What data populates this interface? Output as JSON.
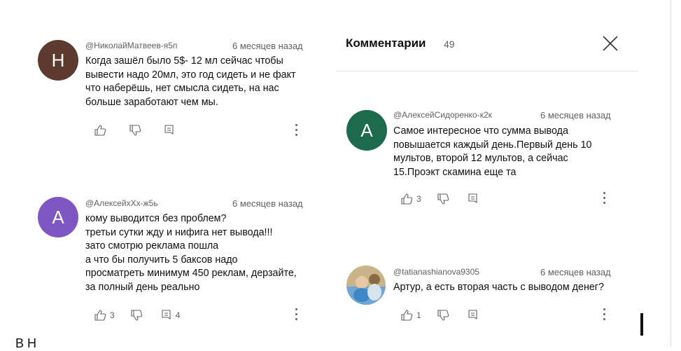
{
  "header": {
    "title": "Комментарии",
    "count": "49"
  },
  "comments_left": [
    {
      "avatar_letter": "Н",
      "avatar_color": "#5d3a2e",
      "author": "@НиколайМатвеев-я5п",
      "time": "6 месяцев назад",
      "text": "Когда зашёл было 5$- 12 мл сейчас чтобы\nвывести надо 20мл, это год сидеть и не факт\nчто наберёшь, нет смысла сидеть, на нас\nбольше заработают чем мы.",
      "likes": "",
      "replies": ""
    },
    {
      "avatar_letter": "А",
      "avatar_color": "#7e57c2",
      "author": "@АлексейхХх-ж5ь",
      "time": "6 месяцев назад",
      "text": "кому выводится без проблем?\nтретьи сутки жду и нифига нет вывода!!!\nзато смотрю реклама пошла\nа что бы получить 5 баксов надо\nпросматреть минимум 450 реклам, дерзайте,\nза полный день реально",
      "likes": "3",
      "replies": "4"
    }
  ],
  "comments_right": [
    {
      "avatar_letter": "А",
      "avatar_color": "#1e6a4e",
      "author": "@АлексейСидоренко-к2к",
      "time": "6 месяцев назад",
      "text": "Самое интересное что сумма вывода\nповышается каждый день.Первый день 10\nмультов, второй 12 мультов, а сейчас\n15.Проэкт скамина еще та",
      "likes": "3"
    },
    {
      "avatar_letter": "",
      "avatar_color": "#8fb8d8",
      "author": "@tatianashianova9305",
      "time": "6 месяцев назад",
      "text": "Артур,  а есть вторая часть с выводом денег?",
      "likes": "1"
    }
  ],
  "bottom": {
    "text": "В Н"
  }
}
